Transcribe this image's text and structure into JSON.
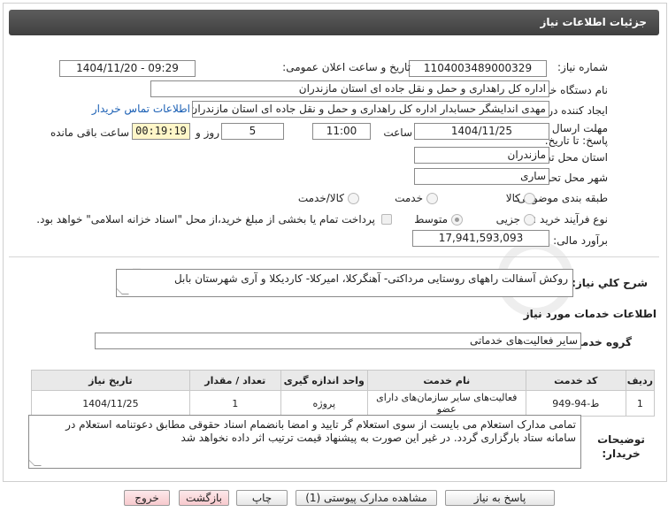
{
  "header": {
    "title": "جزئیات اطلاعات نیاز"
  },
  "fields": {
    "need_number_label": "شماره نیاز:",
    "need_number": "1104003489000329",
    "announce_label": "تاریخ و ساعت اعلان عمومی:",
    "announce_value": "1404/11/20 - 09:29",
    "buyer_org_label": "نام دستگاه خریدار:",
    "buyer_org": "اداره کل راهداری و حمل و نقل جاده ای استان مازندران",
    "creator_label": "ایجاد کننده درخواست:",
    "creator": "مهدی اندایشگر حسابدار اداره کل راهداری و حمل و نقل جاده ای استان مازندران",
    "contact_link": "اطلاعات تماس خریدار",
    "deadline_label": "مهلت ارسال پاسخ: تا تاریخ:",
    "deadline_date": "1404/11/25",
    "time_label": "ساعت",
    "deadline_time": "11:00",
    "days": "5",
    "days_label": "روز و",
    "remaining": "00:19:19",
    "remaining_label": "ساعت باقی مانده",
    "province_label": "استان محل تحویل:",
    "province": "مازندران",
    "city_label": "شهر محل تحویل:",
    "city": "ساری",
    "category_label": "طبقه بندی موضوعی:",
    "category_options": [
      "کالا",
      "خدمت",
      "کالا/خدمت"
    ],
    "process_label": "نوع فرآیند خرید :",
    "process_options": [
      "جزیی",
      "متوسط"
    ],
    "payment_note": "پرداخت تمام یا بخشی از مبلغ خرید،از محل \"اسناد خزانه اسلامی\" خواهد بود.",
    "budget_label": "برآورد مالی:",
    "budget": "17,941,593,093"
  },
  "summary": {
    "label": "شرح کلي نياز:",
    "text": "روکش آسفالت راههای روستایی مرداکتی- آهنگرکلا، امیرکلا- کاردیکلا و آری شهرستان بابل"
  },
  "services": {
    "section_title": "اطلاعات خدمات مورد نیاز",
    "group_label": "گروه خدمت:",
    "group_value": "سایر فعالیت‌های خدماتی"
  },
  "table": {
    "headers": [
      "ردیف",
      "کد خدمت",
      "نام خدمت",
      "واحد اندازه گیری",
      "تعداد / مقدار",
      "تاریخ نیاز"
    ],
    "rows": [
      [
        "1",
        "ط-94-949",
        "فعالیت‌های سایر سازمان‌های دارای عضو",
        "پروژه",
        "1",
        "1404/11/25"
      ]
    ]
  },
  "buyer_notes": {
    "label": "توضیحات خریدار:",
    "text": "تمامی مدارک استعلام می بایست از سوی استعلام گر تایید و امضا بانضمام اسناد حقوقی مطابق دعوتنامه استعلام در سامانه ستاد بارگزاری گردد. در غیر این صورت به پیشنهاد قیمت ترتیب اثر داده نخواهد شد"
  },
  "buttons": {
    "reply": "پاسخ به نیاز",
    "view_docs": "مشاهده مدارک پیوستی (1)",
    "print": "چاپ",
    "back": "بازگشت",
    "exit": "خروج"
  },
  "watermark": "AriaTender.net"
}
